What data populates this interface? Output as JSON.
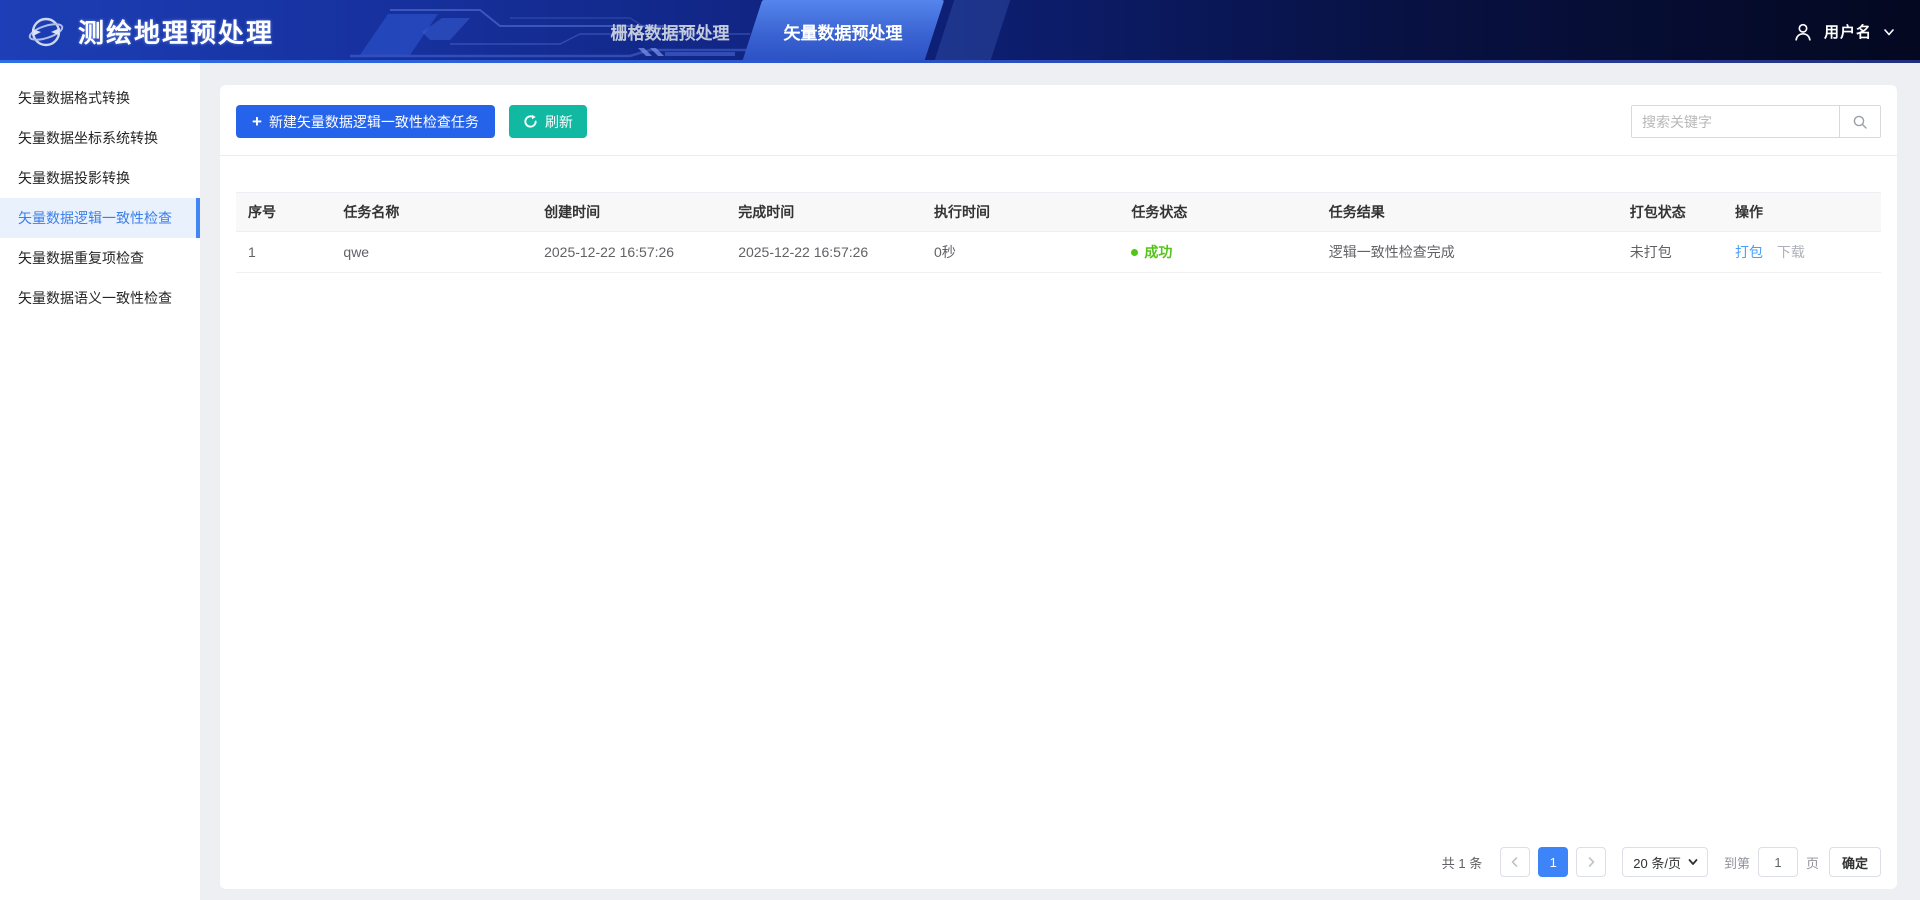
{
  "colors": {
    "primary_blue": "#2563eb",
    "teal": "#12b9a2",
    "success_green": "#52c41a",
    "link_blue": "#4b9ef8",
    "active_page_bg": "#3d84f8",
    "header_bottom_line": "#2e6fe8",
    "sidebar_active_bg": "#e9f1fc",
    "sidebar_active_text": "#3d7fe8"
  },
  "icons": {
    "logo": "orbit-globe",
    "user": "person-outline",
    "user_dropdown": "chevron-down",
    "new_task": "plus",
    "refresh": "circular-arrow",
    "search": "magnifier",
    "page_prev": "chevron-left",
    "page_next": "chevron-right",
    "page_size": "chevron-down"
  },
  "header": {
    "app_title": "测绘地理预处理",
    "tabs": [
      {
        "label": "栅格数据预处理",
        "active": false
      },
      {
        "label": "矢量数据预处理",
        "active": true
      }
    ],
    "username": "用户名"
  },
  "sidebar": {
    "items": [
      {
        "label": "矢量数据格式转换",
        "active": false
      },
      {
        "label": "矢量数据坐标系统转换",
        "active": false
      },
      {
        "label": "矢量数据投影转换",
        "active": false
      },
      {
        "label": "矢量数据逻辑一致性检查",
        "active": true
      },
      {
        "label": "矢量数据重复项检查",
        "active": false
      },
      {
        "label": "矢量数据语义一致性检查",
        "active": false
      }
    ]
  },
  "toolbar": {
    "new_task_label": "新建矢量数据逻辑一致性检查任务",
    "refresh_label": "刷新",
    "search_placeholder": "搜索关键字"
  },
  "table": {
    "columns": [
      "序号",
      "任务名称",
      "创建时间",
      "完成时间",
      "执行时间",
      "任务状态",
      "任务结果",
      "打包状态",
      "操作"
    ],
    "rows": [
      {
        "index": "1",
        "name": "qwe",
        "created": "2025-12-22 16:57:26",
        "finished": "2025-12-22 16:57:26",
        "duration": "0秒",
        "status": "成功",
        "result": "逻辑一致性检查完成",
        "package_status": "未打包",
        "actions": {
          "package": "打包",
          "download": "下载"
        }
      }
    ]
  },
  "pagination": {
    "total_label": "共 1 条",
    "current_page": "1",
    "page_size_label": "20 条/页",
    "goto_prefix": "到第",
    "goto_value": "1",
    "goto_suffix": "页",
    "confirm_label": "确定"
  }
}
